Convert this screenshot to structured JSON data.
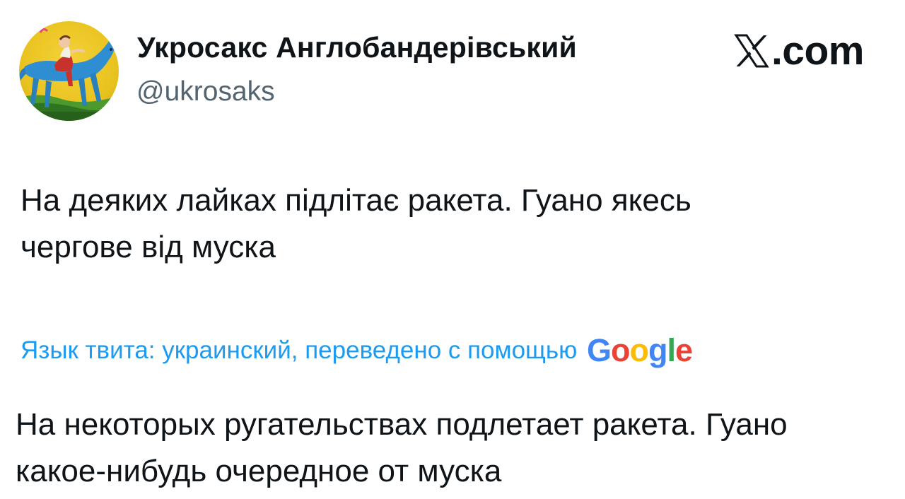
{
  "author": {
    "display_name": "Укросакс Англобандерівський",
    "handle": "@ukrosaks",
    "avatar_icon": "avatar-painting-rider-on-blue-horse"
  },
  "brand": {
    "logo_icon": "x-logo-icon",
    "domain": ".com"
  },
  "tweet": {
    "text_lines": [
      "На деяких лайках підлітає ракета. Гуано якесь",
      "чергове від муска"
    ]
  },
  "translation": {
    "label": "Язык твита: украинский, переведено с помощью",
    "provider_logo": "google-logo",
    "provider_wordmark": "Google",
    "text_lines": [
      "На некоторых ругательствах подлетает ракета. Гуано",
      "какое-нибудь очередное от муска"
    ]
  },
  "colors": {
    "text_primary": "#0f1419",
    "text_secondary": "#536471",
    "link_blue": "#1d9bf0",
    "google_blue": "#4285f4",
    "google_red": "#ea4335",
    "google_yellow": "#fbbc05",
    "google_green": "#34a853"
  }
}
